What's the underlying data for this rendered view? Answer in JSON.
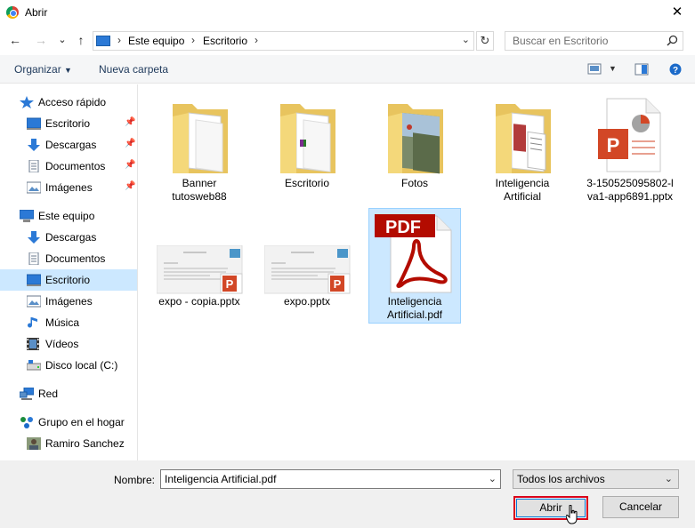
{
  "window": {
    "title": "Abrir",
    "close_glyph": "✕"
  },
  "nav": {
    "back_glyph": "←",
    "forward_glyph": "→",
    "recent_glyph": "⌄",
    "up_glyph": "↑",
    "breadcrumb": [
      "Este equipo",
      "Escritorio"
    ],
    "refresh_glyph": "↻",
    "search_placeholder": "Buscar en Escritorio"
  },
  "toolbar": {
    "organize": "Organizar",
    "new_folder": "Nueva carpeta"
  },
  "sidebar": {
    "items": [
      {
        "label": "Acceso rápido",
        "icon": "star-icon",
        "pinned": false
      },
      {
        "label": "Escritorio",
        "icon": "desktop-icon",
        "pinned": true
      },
      {
        "label": "Descargas",
        "icon": "download-icon",
        "pinned": true
      },
      {
        "label": "Documentos",
        "icon": "documents-icon",
        "pinned": true
      },
      {
        "label": "Imágenes",
        "icon": "pictures-icon",
        "pinned": true
      },
      {
        "label": "Este equipo",
        "icon": "computer-icon",
        "pinned": false
      },
      {
        "label": "Descargas",
        "icon": "download-icon",
        "pinned": false
      },
      {
        "label": "Documentos",
        "icon": "documents-icon",
        "pinned": false
      },
      {
        "label": "Escritorio",
        "icon": "desktop-icon",
        "pinned": false,
        "selected": true
      },
      {
        "label": "Imágenes",
        "icon": "pictures-icon",
        "pinned": false
      },
      {
        "label": "Música",
        "icon": "music-icon",
        "pinned": false
      },
      {
        "label": "Vídeos",
        "icon": "videos-icon",
        "pinned": false
      },
      {
        "label": "Disco local (C:)",
        "icon": "drive-icon",
        "pinned": false
      },
      {
        "label": "Red",
        "icon": "network-icon",
        "pinned": false
      },
      {
        "label": "Grupo en el hogar",
        "icon": "homegroup-icon",
        "pinned": false
      },
      {
        "label": "Ramiro Sanchez",
        "icon": "user-icon",
        "pinned": false
      }
    ]
  },
  "files": [
    {
      "line1": "Banner",
      "line2": "tutosweb88",
      "type": "folder"
    },
    {
      "line1": "Escritorio",
      "line2": "",
      "type": "folder"
    },
    {
      "line1": "Fotos",
      "line2": "",
      "type": "folder"
    },
    {
      "line1": "Inteligencia",
      "line2": "Artificial",
      "type": "folder"
    },
    {
      "line1": "3-150525095802-l",
      "line2": "va1-app6891.pptx",
      "type": "pptx"
    },
    {
      "line1": "expo - copia.pptx",
      "line2": "",
      "type": "pptx-thumb"
    },
    {
      "line1": "expo.pptx",
      "line2": "",
      "type": "pptx-thumb"
    },
    {
      "line1": "Inteligencia",
      "line2": "Artificial.pdf",
      "type": "pdf",
      "selected": true,
      "badge": "PDF"
    }
  ],
  "footer": {
    "name_label": "Nombre:",
    "name_value": "Inteligencia Artificial.pdf",
    "filter_value": "Todos los archivos",
    "open_button": "Abrir",
    "cancel_button": "Cancelar",
    "dropdown_glyph": "⌄"
  },
  "colors": {
    "selection": "#cce8ff",
    "accent": "#0078d7",
    "highlight_border": "#d9001b"
  }
}
